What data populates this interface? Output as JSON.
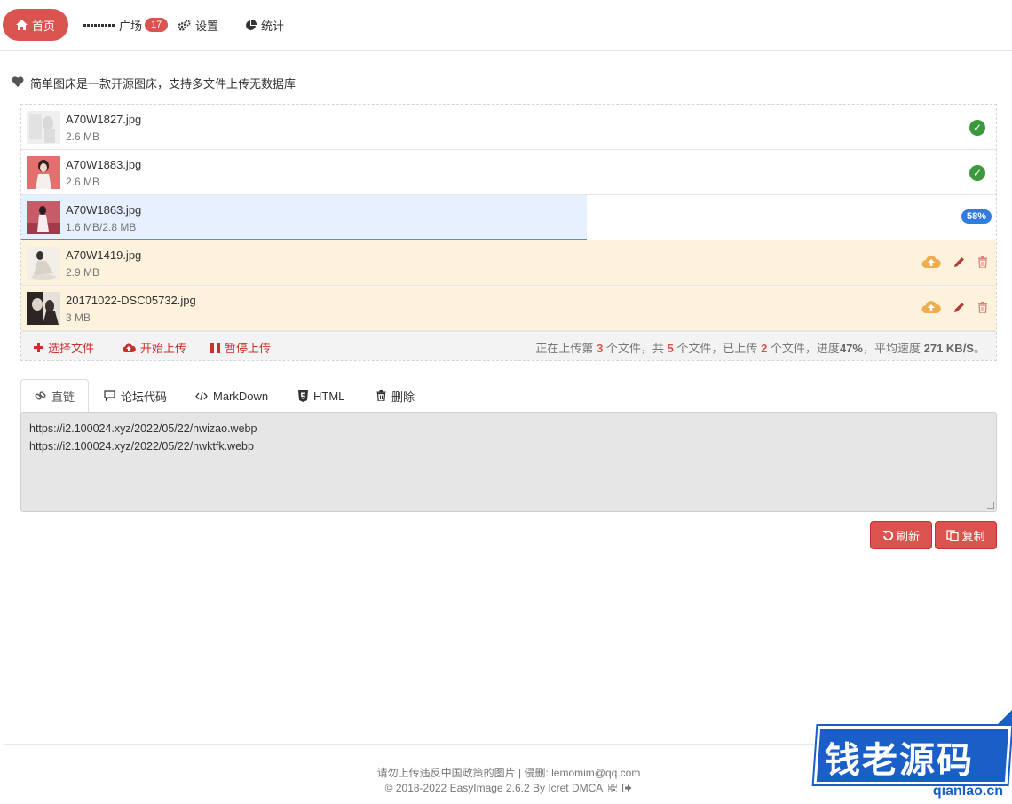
{
  "nav": {
    "home": "首页",
    "plaza": "广场",
    "plaza_count": "17",
    "settings": "设置",
    "stats": "统计"
  },
  "intro": "简单图床是一款开源图床，支持多文件上传无数据库",
  "files": [
    {
      "name": "A70W1827.jpg",
      "size": "2.6 MB",
      "status": "done"
    },
    {
      "name": "A70W1883.jpg",
      "size": "2.6 MB",
      "status": "done"
    },
    {
      "name": "A70W1863.jpg",
      "size": "1.6 MB/2.8 MB",
      "status": "uploading",
      "progress": "58%",
      "progress_fraction": 0.58
    },
    {
      "name": "A70W1419.jpg",
      "size": "2.9 MB",
      "status": "pending"
    },
    {
      "name": "20171022-DSC05732.jpg",
      "size": "3 MB",
      "status": "pending"
    }
  ],
  "controls": {
    "select": "选择文件",
    "start": "开始上传",
    "pause": "暂停上传"
  },
  "status": {
    "p1": "正在上传第",
    "current": "3",
    "p2": "个文件，共",
    "total": "5",
    "p3": "个文件，已上传",
    "uploaded": "2",
    "p4": "个文件，进度",
    "progress": "47%",
    "p5": "，平均速度",
    "speed": "271 KB/S",
    "p6": "。"
  },
  "tabs": {
    "link": "直链",
    "forum": "论坛代码",
    "markdown": "MarkDown",
    "html": "HTML",
    "delete": "删除"
  },
  "links": [
    "https://i2.100024.xyz/2022/05/22/nwizao.webp",
    "https://i2.100024.xyz/2022/05/22/nwktfk.webp"
  ],
  "buttons": {
    "refresh": "刷新",
    "copy": "复制"
  },
  "footer": {
    "line1": "请勿上传违反中国政策的图片 | 侵删: lemomim@qq.com",
    "line2": "© 2018-2022 EasyImage 2.6.2 By Icret DMCA"
  },
  "watermark": {
    "text": "钱老源码",
    "url": "qianlao.cn"
  },
  "colors": {
    "accent": "#d9534f",
    "success": "#3c9a3c",
    "progress": "#2f7de1",
    "pending_bg": "#fdf2dc",
    "upload_icon": "#f0ad4e"
  }
}
